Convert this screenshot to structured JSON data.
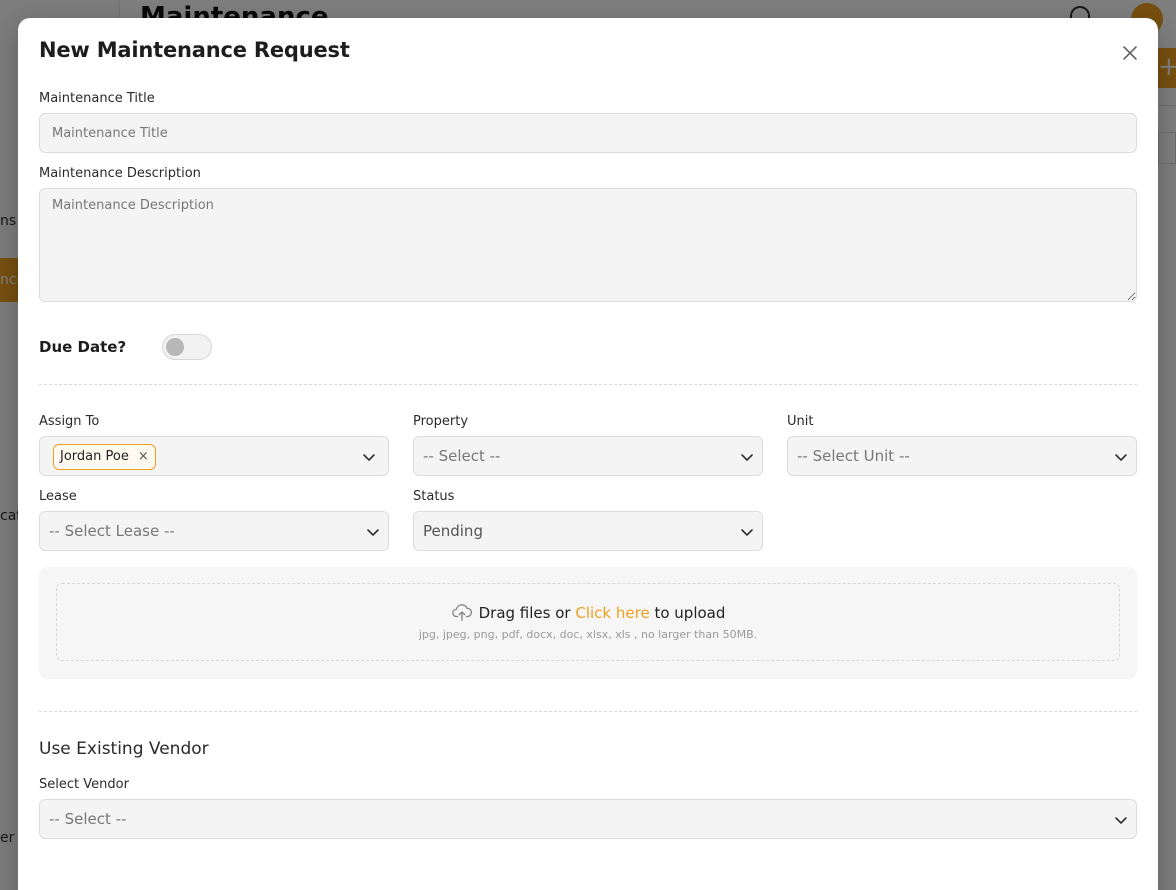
{
  "background": {
    "title": "Maintenance",
    "sidebar_fragments": [
      "ns",
      "nce",
      "cat",
      "er"
    ]
  },
  "modal": {
    "title": "New Maintenance Request",
    "close_icon": "close-icon"
  },
  "form": {
    "title_label": "Maintenance Title",
    "title_placeholder": "Maintenance Title",
    "title_value": "",
    "description_label": "Maintenance Description",
    "description_placeholder": "Maintenance Description",
    "description_value": "",
    "due_date_label": "Due Date?",
    "due_date_enabled": false,
    "assign_to": {
      "label": "Assign To",
      "selected": [
        "Jordan Poe"
      ],
      "remove_glyph": "×"
    },
    "property": {
      "label": "Property",
      "placeholder": "-- Select --"
    },
    "unit": {
      "label": "Unit",
      "placeholder": "-- Select Unit --"
    },
    "lease": {
      "label": "Lease",
      "placeholder": "-- Select Lease --"
    },
    "status": {
      "label": "Status",
      "value": "Pending"
    },
    "upload": {
      "text_before": "Drag files or",
      "link_text": "Click here",
      "text_after": "to upload",
      "hint": "jpg, jpeg, png, pdf, docx, doc, xlsx, xls , no larger than 50MB."
    },
    "vendor": {
      "heading": "Use Existing Vendor",
      "label": "Select Vendor",
      "placeholder": "-- Select --"
    }
  },
  "colors": {
    "accent": "#f0a020",
    "field_bg": "#f4f4f4",
    "field_border": "#dcdcdc"
  }
}
